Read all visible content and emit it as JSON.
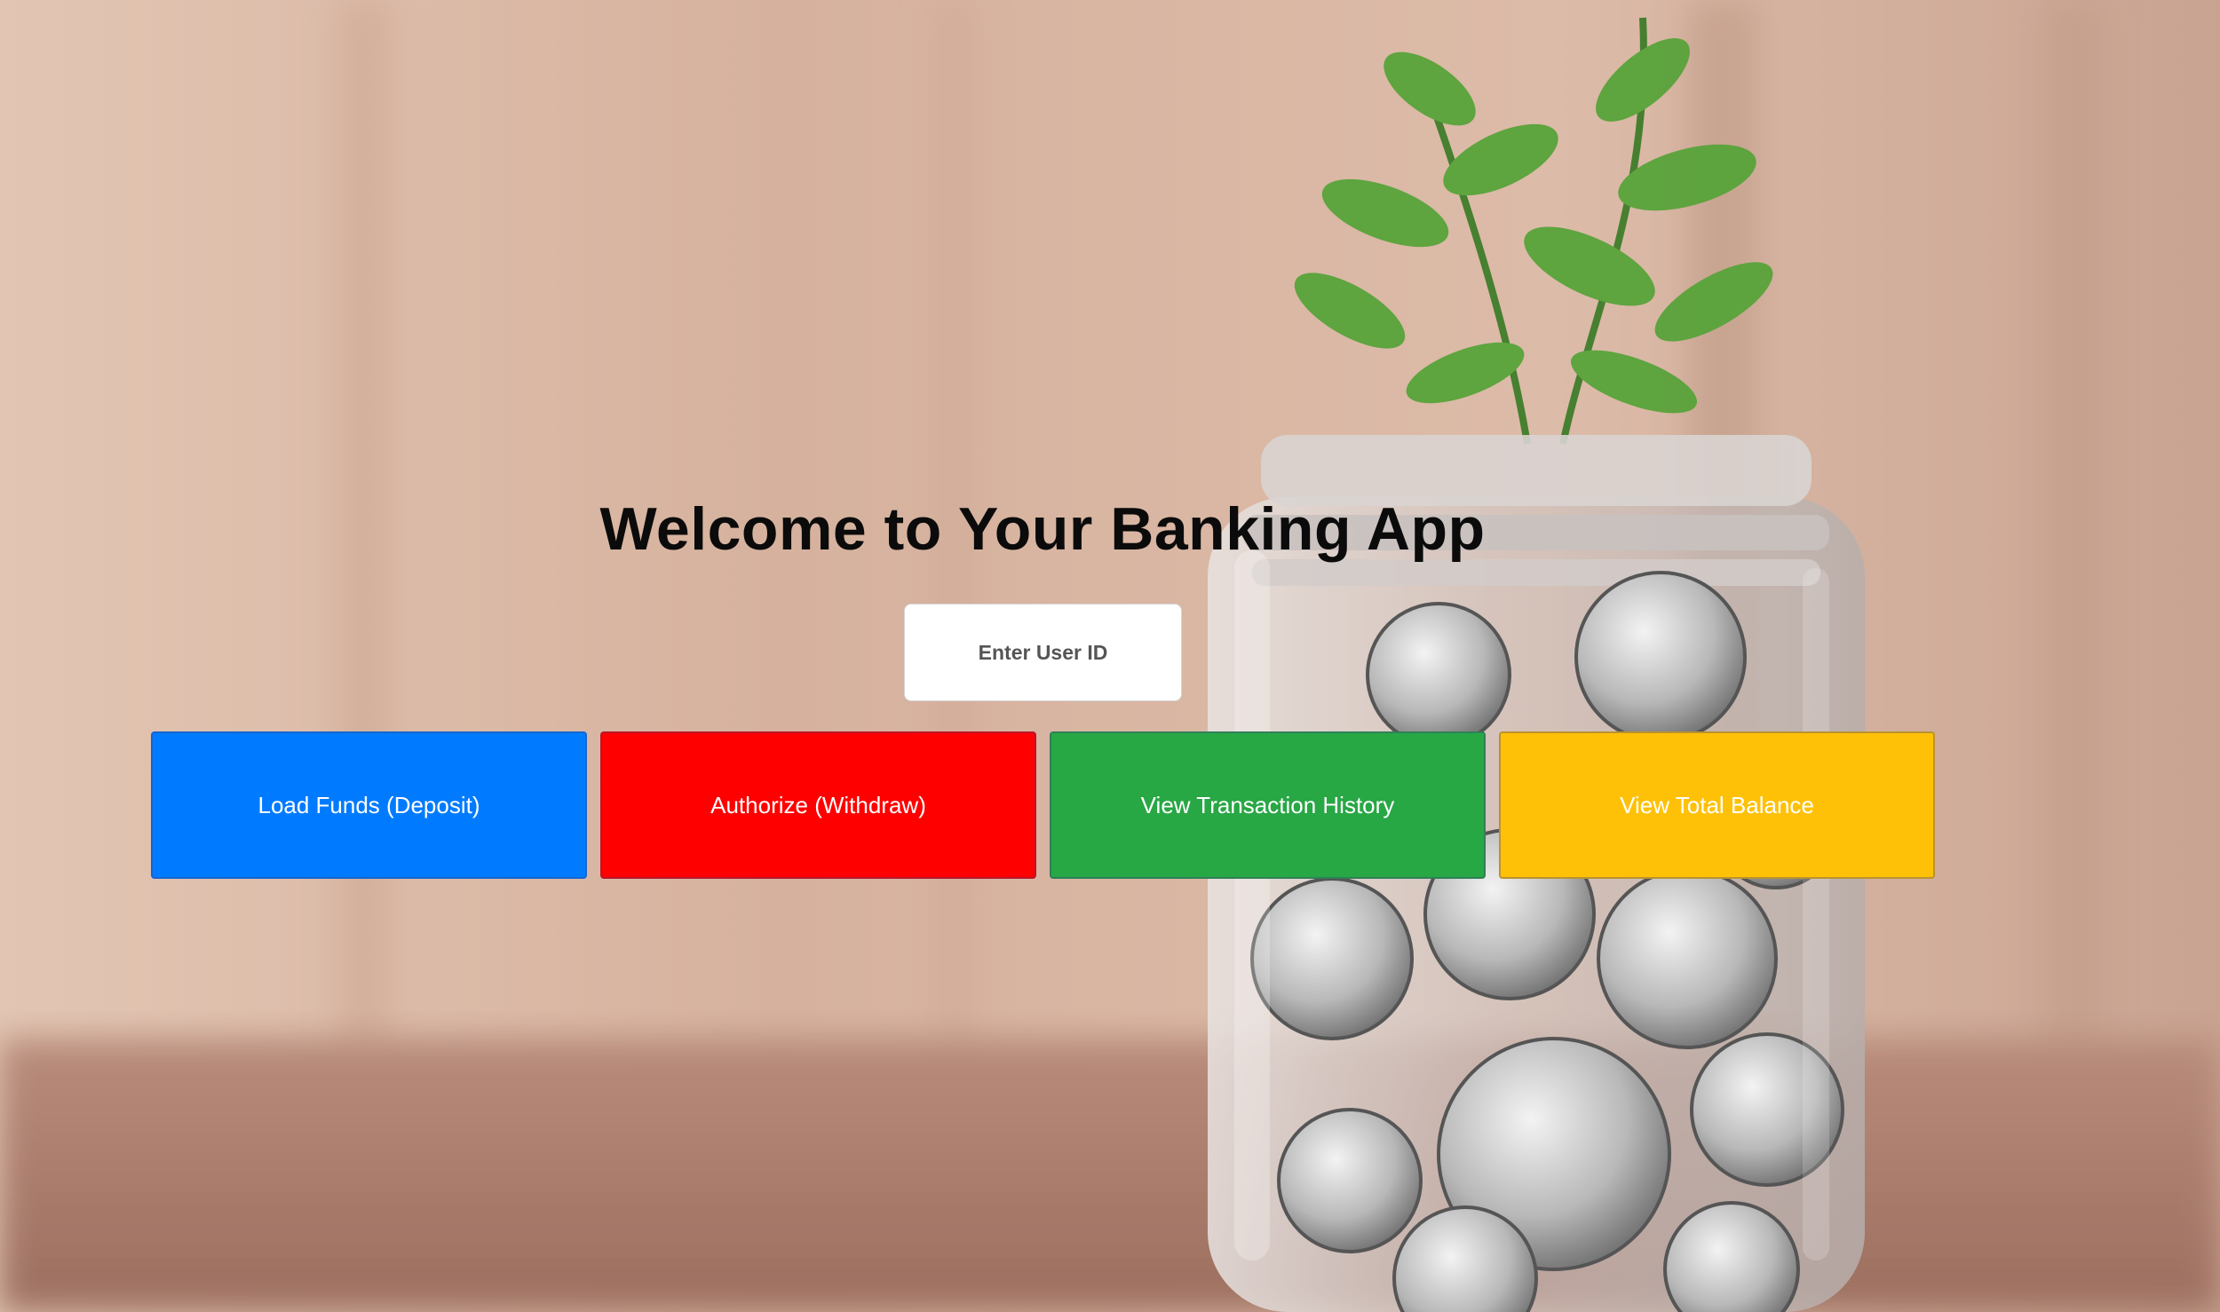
{
  "page": {
    "title": "Welcome to Your Banking App"
  },
  "user_id": {
    "placeholder": "Enter User ID",
    "value": ""
  },
  "actions": [
    {
      "label": "Load Funds (Deposit)",
      "color": "#007bff"
    },
    {
      "label": "Authorize (Withdraw)",
      "color": "#ff0000"
    },
    {
      "label": "View Transaction History",
      "color": "#28a745"
    },
    {
      "label": "View Total Balance",
      "color": "#ffc107"
    }
  ],
  "background": {
    "description_icon": "coin-jar-plant-photo-icon"
  }
}
